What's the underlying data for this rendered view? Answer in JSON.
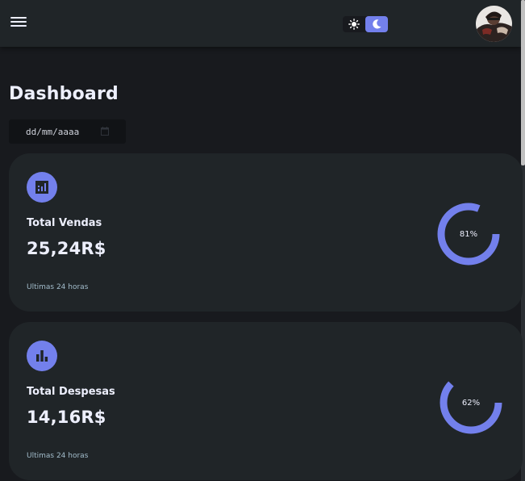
{
  "topbar": {
    "menu_icon": "menu-icon",
    "theme_toggler": {
      "options": [
        "light-mode-icon",
        "dark-mode-icon"
      ],
      "active": "dark-mode-icon"
    },
    "profile_icon": "avatar"
  },
  "main": {
    "title": "Dashboard",
    "date_filter": {
      "placeholder": "dd/mm/aaaa",
      "icon": "calendar-icon"
    },
    "cards": [
      {
        "icon": "analytics-icon",
        "label": "Total Vendas",
        "value": "25,24R$",
        "percent": 81,
        "percent_label": "81%",
        "subtitle": "Ultimas 24 horas"
      },
      {
        "icon": "bar-chart-icon",
        "label": "Total Despesas",
        "value": "14,16R$",
        "percent": 62,
        "percent_label": "62%",
        "subtitle": "Ultimas 24 horas"
      }
    ]
  },
  "colors": {
    "background": "#181a1e",
    "surface": "#202528",
    "primary": "#7380ec",
    "text": "#edeffd",
    "muted": "#a3bdcc"
  }
}
